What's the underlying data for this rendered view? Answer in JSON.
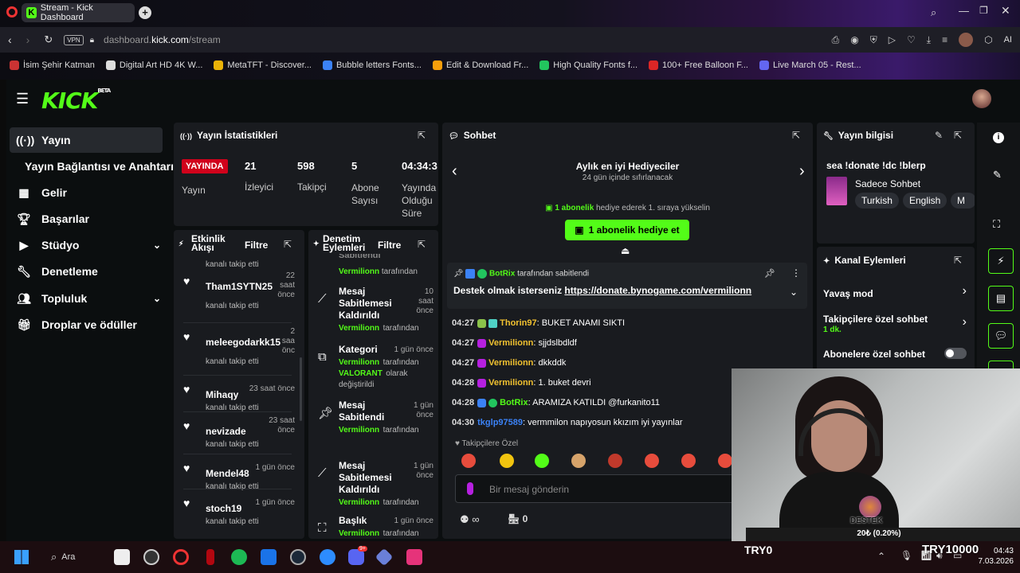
{
  "browser": {
    "tab_title": "Stream - Kick Dashboard",
    "vpn": "VPN",
    "url_prefix": "dashboard.",
    "url_domain": "kick.com",
    "url_path": "/stream",
    "ai_label": "AI",
    "bookmarks": [
      {
        "label": "İsim Şehir Katman",
        "color": "#c33"
      },
      {
        "label": "Digital Art HD 4K W...",
        "color": "#ddd"
      },
      {
        "label": "MetaTFT - Discover...",
        "color": "#eab308"
      },
      {
        "label": "Bubble letters Fonts...",
        "color": "#3b82f6"
      },
      {
        "label": "Edit & Download Fr...",
        "color": "#f59e0b"
      },
      {
        "label": "High Quality Fonts f...",
        "color": "#22c55e"
      },
      {
        "label": "100+ Free Balloon F...",
        "color": "#dc2626"
      },
      {
        "label": "Live March 05 - Rest...",
        "color": "#6366f1"
      }
    ]
  },
  "kick": {
    "logo": "KICK",
    "beta": "BETA",
    "nav": {
      "yayin": "Yayın",
      "baglanti": "Yayın Bağlantısı ve Anahtarı",
      "gelir": "Gelir",
      "basarilar": "Başarılar",
      "studyo": "Stüdyo",
      "denetleme": "Denetleme",
      "topluluk": "Topluluk",
      "droplar": "Droplar ve ödüller"
    },
    "stats": {
      "title": "Yayın İstatistikleri",
      "live_badge": "YAYINDA",
      "live_label": "Yayın",
      "viewers_value": "21",
      "viewers_label": "İzleyici",
      "followers_value": "598",
      "followers_label": "Takipçi",
      "subs_value": "5",
      "subs_label1": "Abone",
      "subs_label2": "Sayısı",
      "uptime_value": "04:34:3",
      "uptime_label1": "Yayında",
      "uptime_label2": "Olduğu",
      "uptime_label3": "Süre"
    },
    "activity": {
      "title1": "Etkinlik",
      "title2": "Akışı",
      "filter": "Filtre",
      "top_partial": "kanalı takip etti",
      "items": [
        {
          "name": "Tham1SYTN25",
          "time1": "22",
          "time2": "saat",
          "time3": "önce",
          "sub": "kanalı takip etti"
        },
        {
          "name": "meleegodarkk15",
          "time1": "2",
          "time2": "saa",
          "time3": "önc",
          "sub": "kanalı takip etti"
        },
        {
          "name": "Mihaqy",
          "time1": "23 saat önce",
          "time2": "",
          "time3": "",
          "sub": "kanalı takip etti"
        },
        {
          "name": "nevizade",
          "time1": "23 saat",
          "time2": "önce",
          "time3": "",
          "sub": "kanalı takip etti"
        },
        {
          "name": "Mendel48",
          "time1": "1 gün önce",
          "time2": "",
          "time3": "",
          "sub": "kanalı takip etti"
        },
        {
          "name": "stoch19",
          "time1": "1 gün önce",
          "time2": "",
          "time3": "",
          "sub": "kanalı takip etti"
        }
      ]
    },
    "mod": {
      "title1": "Denetim",
      "title2": "Eylemleri",
      "filter": "Filtre",
      "top_partial_title": "Sabitlendi",
      "top_partial_user": "Vermilionn",
      "top_partial_rest": "tarafından",
      "items": [
        {
          "title": "Mesaj Sabitlemesi Kaldırıldı",
          "time1": "10",
          "time2": "saat",
          "time3": "önce",
          "user": "Vermilionn",
          "rest": "tarafından"
        },
        {
          "title": "Kategori",
          "time1": "1 gün önce",
          "time2": "",
          "time3": "",
          "user": "Vermilionn",
          "rest": "tarafından",
          "extra_user": "VALORANT",
          "extra_rest": "olarak",
          "extra2": "değiştirildi"
        },
        {
          "title": "Mesaj Sabitlendi",
          "time1": "1 gün",
          "time2": "önce",
          "time3": "",
          "user": "Vermilionn",
          "rest": "tarafından"
        },
        {
          "title": "Mesaj Sabitlemesi Kaldırıldı",
          "time1": "1 gün",
          "time2": "önce",
          "time3": "",
          "user": "Vermilionn",
          "rest": "tarafından"
        },
        {
          "title": "Başlık",
          "time1": "1 gün önce",
          "time2": "",
          "time3": "",
          "user": "Vermilionn",
          "rest": "tarafından"
        }
      ]
    },
    "chat": {
      "title": "Sohbet",
      "gifters_title": "Aylık en iyi Hediyeciler",
      "gifters_sub": "24 gün içinde sıfırlanacak",
      "promo_bold": "1 abonelik",
      "promo_rest": "hediye ederek 1. sıraya yükselin",
      "gift_button": "1 abonelik hediye et",
      "pinned_by_user": "BotRix",
      "pinned_by_rest": "tarafından sabitlendi",
      "pinned_text": "Destek olmak isterseniz",
      "pinned_link": "https://donate.bynogame.com/vermilionn",
      "messages": [
        {
          "time": "04:27",
          "user": "Thorin97",
          "color": "#f2c230",
          "text": "BUKET ANAMI SIKTI"
        },
        {
          "time": "04:27",
          "user": "Vermilionn",
          "color": "#f2c230",
          "text": "sjjdslbdldf"
        },
        {
          "time": "04:27",
          "user": "Vermilionn",
          "color": "#f2c230",
          "text": "dkkddk"
        },
        {
          "time": "04:28",
          "user": "Vermilionn",
          "color": "#f2c230",
          "text": "1. buket devri"
        },
        {
          "time": "04:28",
          "user": "BotRix",
          "color": "#53fc18",
          "text": "ARAMIZA KATILDI @furkanito11"
        },
        {
          "time": "04:30",
          "user": "tkglp97589",
          "color": "#3b82f6",
          "text": "vermmilon napıyosun kkızım iyi yayınlar"
        }
      ],
      "followers_only": "Takipçilere Özel",
      "input_placeholder": "Bir mesaj gönderin",
      "infinity": "∞",
      "count": "0"
    },
    "info": {
      "title": "Yayın bilgisi",
      "stream_title": "sea !donate !dc !blerp",
      "category": "Sadece Sohbet",
      "tags": [
        "Turkish",
        "English",
        "M"
      ]
    },
    "actions": {
      "title": "Kanal Eylemleri",
      "slow_mode": "Yavaş mod",
      "followers_chat": "Takipçilere özel sohbet",
      "followers_chat_value": "1 dk.",
      "subs_chat": "Abonelere özel sohbet"
    }
  },
  "webcam": {
    "badge": "DESTEK",
    "amount": "20₺ (0.20%)"
  },
  "overlay": {
    "try0": "TRY0",
    "try10000": "TRY10000"
  },
  "taskbar": {
    "search": "Ara",
    "time": "04:43",
    "date": "7.03.2026",
    "discord_badge": "9+"
  }
}
